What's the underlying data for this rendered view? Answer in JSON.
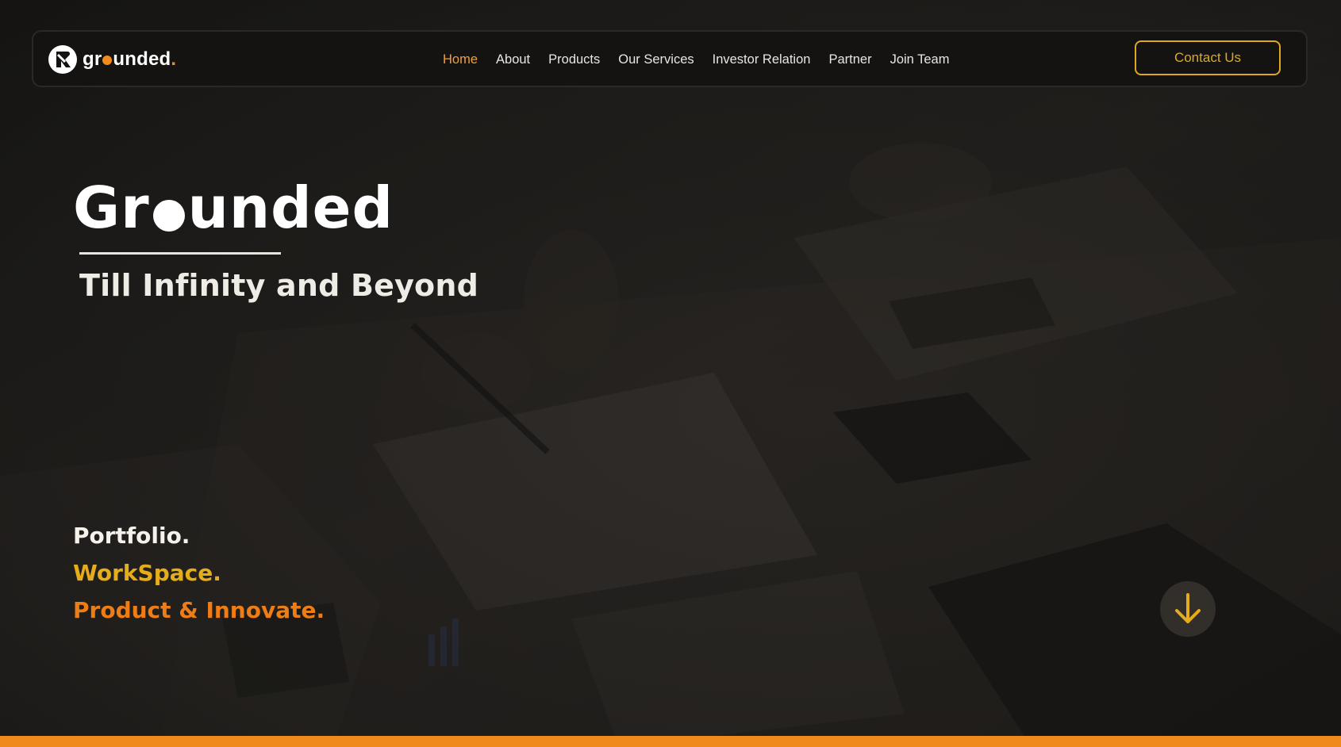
{
  "brand": {
    "name_prefix": "gr",
    "name_suffix": "unded",
    "name_period": ".",
    "logo_icon": "grounded-logo-icon"
  },
  "nav": {
    "items": [
      {
        "label": "Home",
        "active": true
      },
      {
        "label": "About",
        "active": false
      },
      {
        "label": "Products",
        "active": false
      },
      {
        "label": "Our Services",
        "active": false
      },
      {
        "label": "Investor Relation",
        "active": false
      },
      {
        "label": "Partner",
        "active": false
      },
      {
        "label": "Join Team",
        "active": false
      }
    ],
    "contact_label": "Contact Us"
  },
  "hero": {
    "title_prefix": "Gr",
    "title_suffix": "unded",
    "tagline": "Till Infinity and Beyond",
    "features": [
      "Portfolio.",
      "WorkSpace.",
      "Product & Innovate."
    ],
    "scroll_icon": "arrow-down-icon"
  },
  "colors": {
    "accent_orange": "#f08a1c",
    "accent_gold": "#e6ad1a",
    "active_nav": "#f0a03a",
    "background": "#1b1a18"
  }
}
